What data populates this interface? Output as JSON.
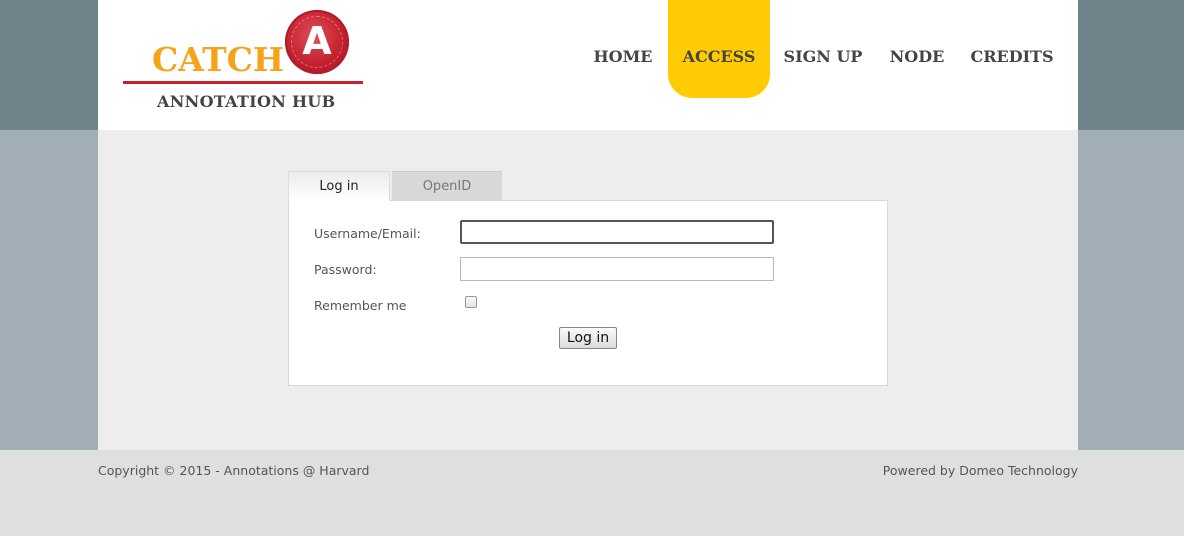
{
  "logo": {
    "main": "CATCH",
    "badge": "A",
    "sub": "ANNOTATION HUB"
  },
  "nav": {
    "home": "HOME",
    "access": "ACCESS",
    "signup": "SIGN UP",
    "node": "NODE",
    "credits": "CREDITS",
    "active": "ACCESS"
  },
  "tabs": {
    "login": "Log in",
    "openid": "OpenID"
  },
  "form": {
    "username_label": "Username/Email:",
    "username_value": "",
    "password_label": "Password:",
    "password_value": "",
    "remember_label": "Remember me",
    "remember_checked": false,
    "submit_label": "Log in"
  },
  "footer": {
    "copyright": "Copyright © 2015 - Annotations @ Harvard",
    "powered": "Powered by Domeo Technology"
  },
  "colors": {
    "accent": "#ffcb05",
    "logo_orange": "#f5a31a",
    "logo_red": "#c4202e",
    "header_band": "#71838b",
    "body_band": "#a1aeb6"
  }
}
